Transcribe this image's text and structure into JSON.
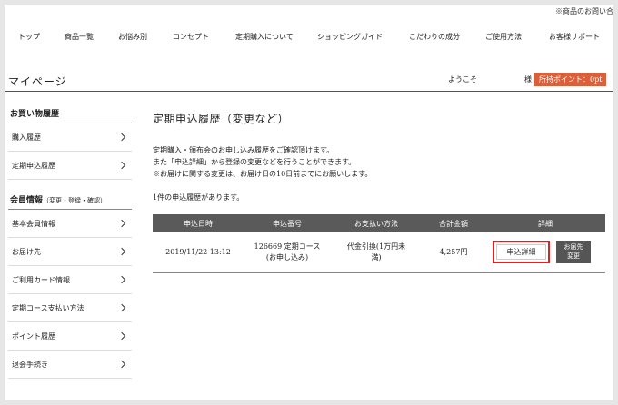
{
  "header": {
    "notice": "※商品のお問い合"
  },
  "gnav": [
    {
      "label": "トップ"
    },
    {
      "label": "商品一覧"
    },
    {
      "label": "お悩み別"
    },
    {
      "label": "コンセプト"
    },
    {
      "label": "定期購入について"
    },
    {
      "label": "ショッピングガイド"
    },
    {
      "label": "こだわりの成分"
    },
    {
      "label": "ご使用方法"
    },
    {
      "label": "お客様サポート"
    }
  ],
  "mypage": {
    "title": "マイページ",
    "welcome": "ようこそ",
    "sama": "様",
    "points": "所持ポイント：0pt"
  },
  "sidebar": {
    "shopping_head": "お買い物履歴",
    "shopping_items": [
      "購入履歴",
      "定期申込履歴"
    ],
    "member_head": "会員情報",
    "member_head_note": "（変更・登録・確認）",
    "member_items": [
      "基本会員情報",
      "お届け先",
      "ご利用カード情報",
      "定期コース支払い方法",
      "ポイント履歴",
      "退会手続き"
    ]
  },
  "main": {
    "title": "定期申込履歴（変更など）",
    "desc": [
      "定期購入・頒布会のお申し込み履歴をご確認頂けます。",
      "また「申込詳細」から登録の変更などを行うことができます。",
      "※お届けに関する変更は、お届け日の10日前までにお願いします。"
    ],
    "count": "1件の申込履歴があります。",
    "table": {
      "headers": [
        "申込日時",
        "申込番号",
        "お支払い方法",
        "合計金額",
        "詳細"
      ],
      "rows": [
        {
          "date": "2019/11/22 13:12",
          "number_line1": "126669 定期コース",
          "number_line2": "(お申し込み)",
          "payment_line1": "代金引換(1万円未",
          "payment_line2": "満)",
          "total": "4,257円",
          "detail_button": "申込詳細",
          "address_button_line1": "お届先",
          "address_button_line2": "変更"
        }
      ]
    }
  }
}
